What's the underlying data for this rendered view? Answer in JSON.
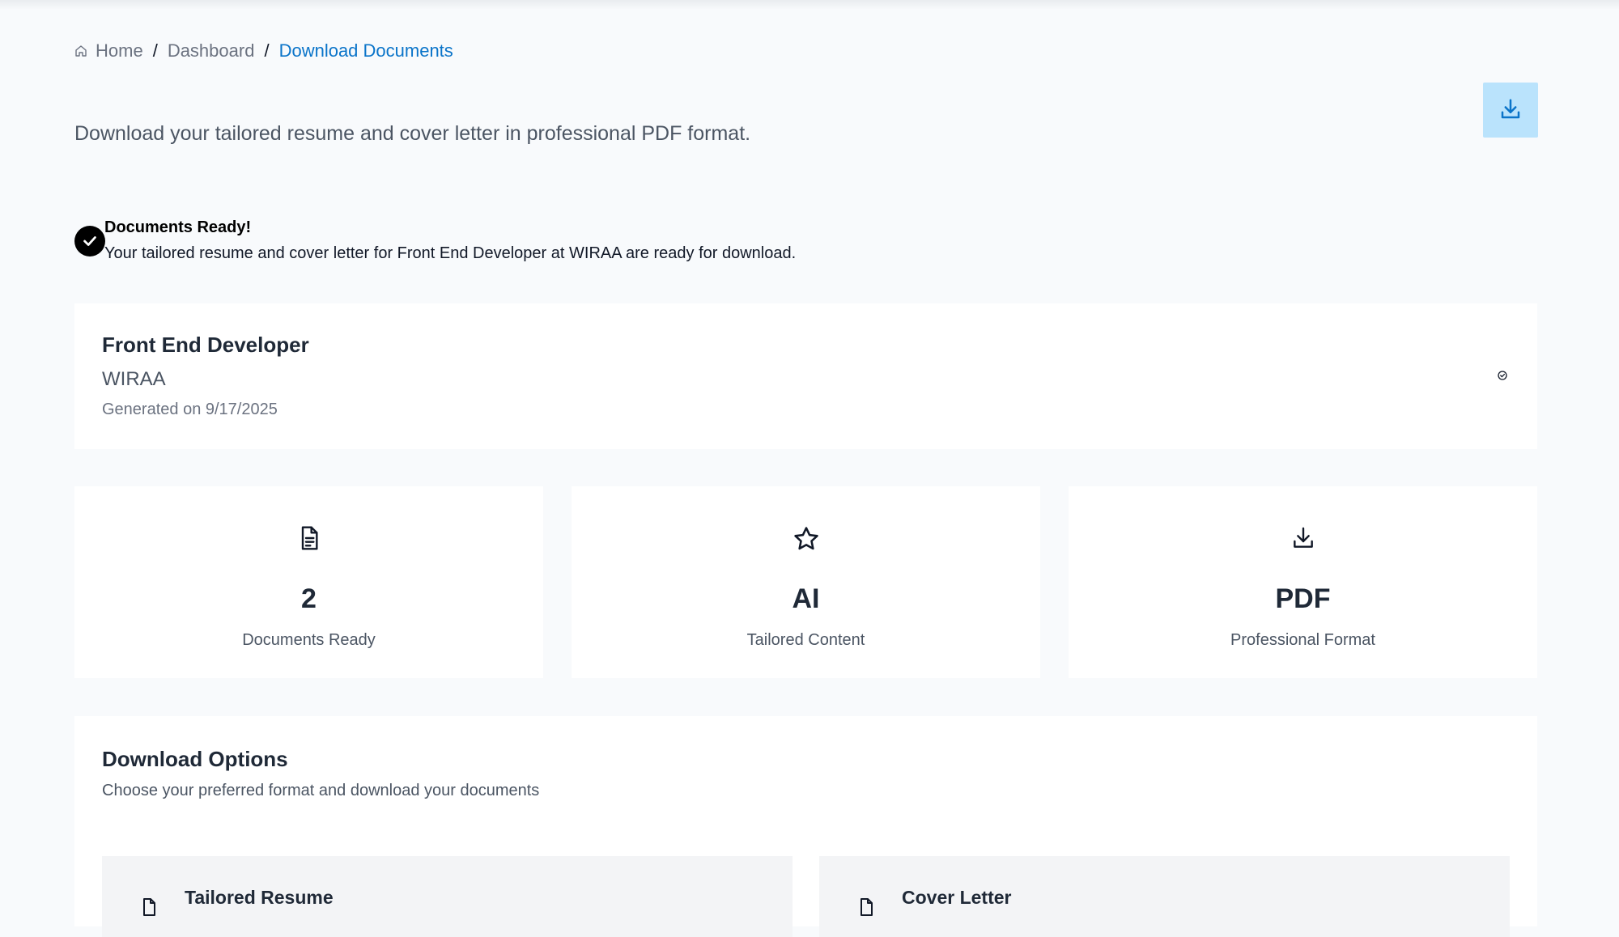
{
  "breadcrumb": {
    "home": "Home",
    "separator": "/",
    "dashboard": "Dashboard",
    "current": "Download Documents"
  },
  "header": {
    "subtitle": "Download your tailored resume and cover letter in professional PDF format."
  },
  "alert": {
    "title": "Documents Ready!",
    "message": "Your tailored resume and cover letter for Front End Developer at WIRAA are ready for download."
  },
  "job": {
    "title": "Front End Developer",
    "company": "WIRAA",
    "generated": "Generated on 9/17/2025"
  },
  "stats": [
    {
      "icon": "document-icon",
      "value": "2",
      "label": "Documents Ready"
    },
    {
      "icon": "star-icon",
      "value": "AI",
      "label": "Tailored Content"
    },
    {
      "icon": "download-icon",
      "value": "PDF",
      "label": "Professional Format"
    }
  ],
  "download_options": {
    "title": "Download Options",
    "subtitle": "Choose your preferred format and download your documents",
    "documents": [
      {
        "icon": "document-icon",
        "title": "Tailored Resume"
      },
      {
        "icon": "document-icon",
        "title": "Cover Letter"
      }
    ]
  },
  "colors": {
    "accent": "#0a74c9",
    "download_button_bg": "#bae3fc",
    "page_bg": "#f8fafc"
  }
}
